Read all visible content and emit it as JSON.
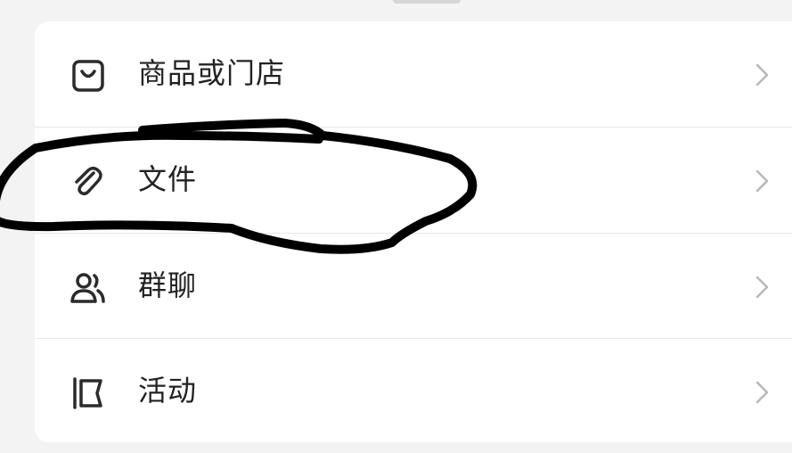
{
  "menu": {
    "items": [
      {
        "label": "商品或门店",
        "icon": "shopping-bag-icon"
      },
      {
        "label": "文件",
        "icon": "paperclip-icon"
      },
      {
        "label": "群聊",
        "icon": "group-users-icon"
      },
      {
        "label": "活动",
        "icon": "activity-flag-icon"
      }
    ],
    "chevron_icon": "chevron-right-icon"
  },
  "colors": {
    "background": "#f3f3f3",
    "card": "#ffffff",
    "text": "#222222",
    "icon": "#2b2b2b",
    "chevron": "#b8b8b8",
    "divider": "#e6e6e6",
    "annotation_stroke": "#000000"
  }
}
